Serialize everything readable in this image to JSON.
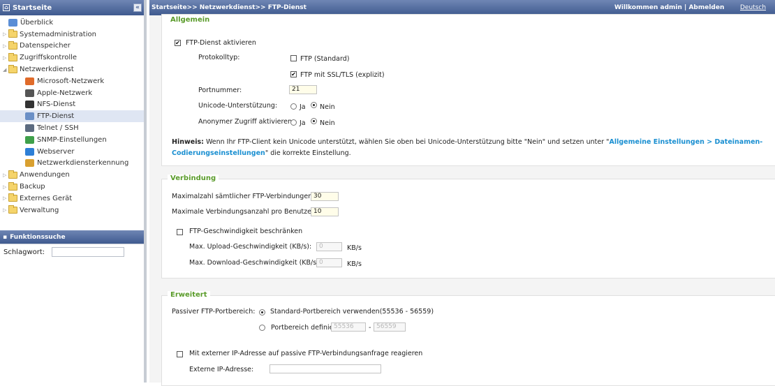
{
  "sidebar": {
    "title": "Startseite",
    "items": [
      {
        "label": "Überblick",
        "level": 0,
        "icon": "overview-icon",
        "arrow": "",
        "selected": false
      },
      {
        "label": "Systemadministration",
        "level": 0,
        "icon": "folder-icon",
        "arrow": "▷",
        "selected": false
      },
      {
        "label": "Datenspeicher",
        "level": 0,
        "icon": "folder-icon",
        "arrow": "▷",
        "selected": false
      },
      {
        "label": "Zugriffskontrolle",
        "level": 0,
        "icon": "folder-icon",
        "arrow": "▷",
        "selected": false
      },
      {
        "label": "Netzwerkdienst",
        "level": 0,
        "icon": "folder-icon",
        "arrow": "◢",
        "selected": false
      },
      {
        "label": "Microsoft-Netzwerk",
        "level": 1,
        "icon": "windows-icon",
        "arrow": "",
        "selected": false
      },
      {
        "label": "Apple-Netzwerk",
        "level": 1,
        "icon": "apple-icon",
        "arrow": "",
        "selected": false
      },
      {
        "label": "NFS-Dienst",
        "level": 1,
        "icon": "linux-icon",
        "arrow": "",
        "selected": false
      },
      {
        "label": "FTP-Dienst",
        "level": 1,
        "icon": "ftp-icon",
        "arrow": "",
        "selected": true
      },
      {
        "label": "Telnet / SSH",
        "level": 1,
        "icon": "terminal-icon",
        "arrow": "",
        "selected": false
      },
      {
        "label": "SNMP-Einstellungen",
        "level": 1,
        "icon": "snmp-icon",
        "arrow": "",
        "selected": false
      },
      {
        "label": "Webserver",
        "level": 1,
        "icon": "globe-icon",
        "arrow": "",
        "selected": false
      },
      {
        "label": "Netzwerkdiensterkennung",
        "level": 1,
        "icon": "discovery-icon",
        "arrow": "",
        "selected": false
      },
      {
        "label": "Anwendungen",
        "level": 0,
        "icon": "folder-icon",
        "arrow": "▷",
        "selected": false
      },
      {
        "label": "Backup",
        "level": 0,
        "icon": "folder-icon",
        "arrow": "▷",
        "selected": false
      },
      {
        "label": "Externes Gerät",
        "level": 0,
        "icon": "folder-icon",
        "arrow": "▷",
        "selected": false
      },
      {
        "label": "Verwaltung",
        "level": 0,
        "icon": "folder-icon",
        "arrow": "▷",
        "selected": false
      }
    ],
    "search": {
      "title": "Funktionssuche",
      "label": "Schlagwort:",
      "value": ""
    }
  },
  "topbar": {
    "breadcrumb": "Startseite>> Netzwerkdienst>> FTP-Dienst",
    "welcome": "Willkommen admin | Abmelden",
    "language": "Deutsch"
  },
  "general": {
    "legend": "Allgemein",
    "enable_label": "FTP-Dienst aktivieren",
    "enable_checked": true,
    "protocol_label": "Protokolltyp:",
    "ftp_standard_label": "FTP (Standard)",
    "ftp_standard_checked": false,
    "ftp_ssl_label": "FTP mit SSL/TLS (explizit)",
    "ftp_ssl_checked": true,
    "port_label": "Portnummer:",
    "port_value": "21",
    "unicode_label": "Unicode-Unterstützung:",
    "unicode_selected": "Nein",
    "anonymous_label": "Anonymer Zugriff aktivieren:",
    "anonymous_selected": "Nein",
    "yes_label": "Ja",
    "no_label": "Nein",
    "hint_prefix": "Hinweis:",
    "hint_text": "Wenn Ihr FTP-Client kein Unicode unterstützt, wählen Sie oben bei Unicode-Unterstützung bitte \"Nein\" und setzen unter \"",
    "hint_link_1": "Allgemeine Einstellungen > Dateinamen-",
    "hint_link_2": "Codierungseinstellungen",
    "hint_suffix": "\" die korrekte Einstellung."
  },
  "connection": {
    "legend": "Verbindung",
    "max_total_label": "Maximalzahl sämtlicher FTP-Verbindungen:",
    "max_total_value": "30",
    "max_per_user_label": "Maximale Verbindungsanzahl pro Benutzer:",
    "max_per_user_value": "10",
    "limit_label": "FTP-Geschwindigkeit beschränken",
    "limit_checked": false,
    "upload_label": "Max. Upload-Geschwindigkeit (KB/s):",
    "upload_value": "0",
    "download_label": "Max. Download-Geschwindigkeit (KB/s):",
    "download_value": "0",
    "unit": "KB/s"
  },
  "advanced": {
    "legend": "Erweitert",
    "passive_label": "Passiver FTP-Portbereich:",
    "default_range_label": "Standard-Portbereich verwenden(55536 - 56559)",
    "default_range_selected": true,
    "define_range_label": "Portbereich definieren:",
    "range_from": "55536",
    "range_sep": "-",
    "range_to": "56559",
    "external_ip_label": "Mit externer IP-Adresse auf passive FTP-Verbindungsanfrage reagieren",
    "external_ip_checked": false,
    "external_ip_field_label": "Externe IP-Adresse:",
    "external_ip_value": ""
  },
  "colors": {
    "header": "#3f5a8f",
    "legend": "#5a9b2a",
    "link": "#1a8fd1",
    "selected_row": "#dfe6f3"
  }
}
